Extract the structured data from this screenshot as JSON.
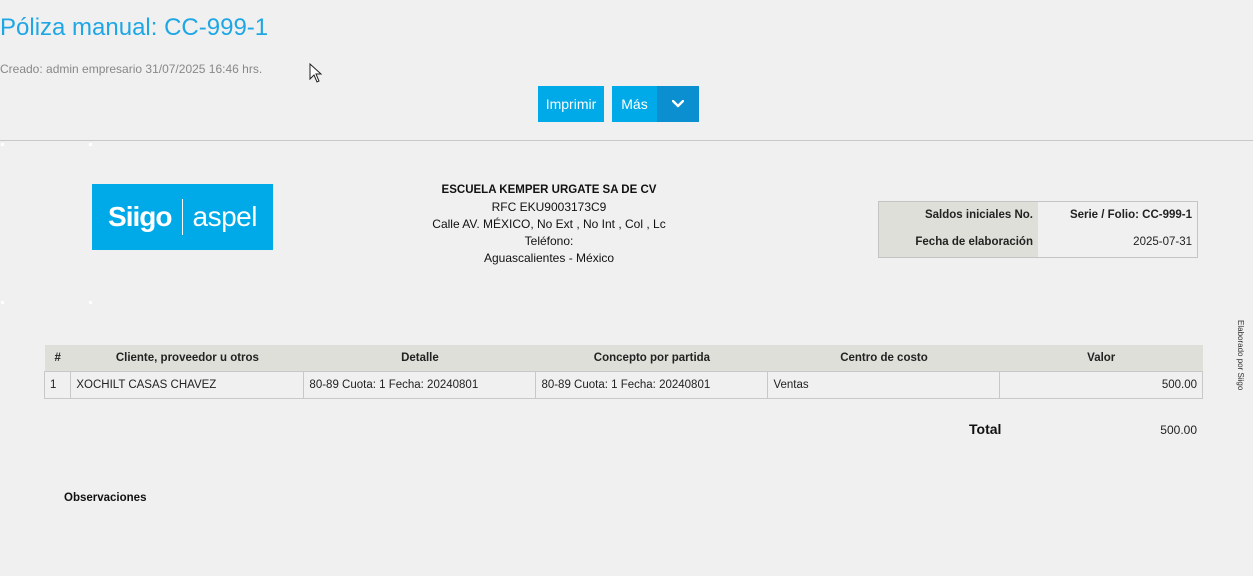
{
  "header": {
    "title": "Póliza manual: CC-999-1",
    "created": "Creado: admin empresario 31/07/2025 16:46 hrs."
  },
  "toolbar": {
    "print_label": "Imprimir",
    "more_label": "Más",
    "more_icon": "chevron-down-icon"
  },
  "brand": {
    "logo_left": "Siigo",
    "logo_right": "aspel",
    "accent_color": "#00a9e8"
  },
  "company": {
    "name": "ESCUELA KEMPER URGATE SA DE CV",
    "rfc": "RFC EKU9003173C9",
    "address": "Calle AV. MÉXICO, No Ext , No Int , Col , Lc",
    "phone": "Teléfono:",
    "city": "Aguascalientes - México"
  },
  "info": {
    "type_label": "Saldos iniciales No.",
    "series_label": "Serie / Folio: CC-999-1",
    "date_label": "Fecha de elaboración",
    "date_value": "2025-07-31"
  },
  "table": {
    "headers": [
      "#",
      "Cliente, proveedor u otros",
      "Detalle",
      "Concepto por partida",
      "Centro de costo",
      "Valor"
    ],
    "rows": [
      [
        "1",
        "XOCHILT CASAS CHAVEZ",
        "80-89 Cuota: 1 Fecha: 20240801",
        "80-89 Cuota: 1 Fecha: 20240801",
        "Ventas",
        "500.00"
      ]
    ]
  },
  "totals": {
    "label": "Total",
    "value": "500.00"
  },
  "footer": {
    "observations_label": "Observaciones",
    "side_text": "Elaborado por Siigo"
  }
}
